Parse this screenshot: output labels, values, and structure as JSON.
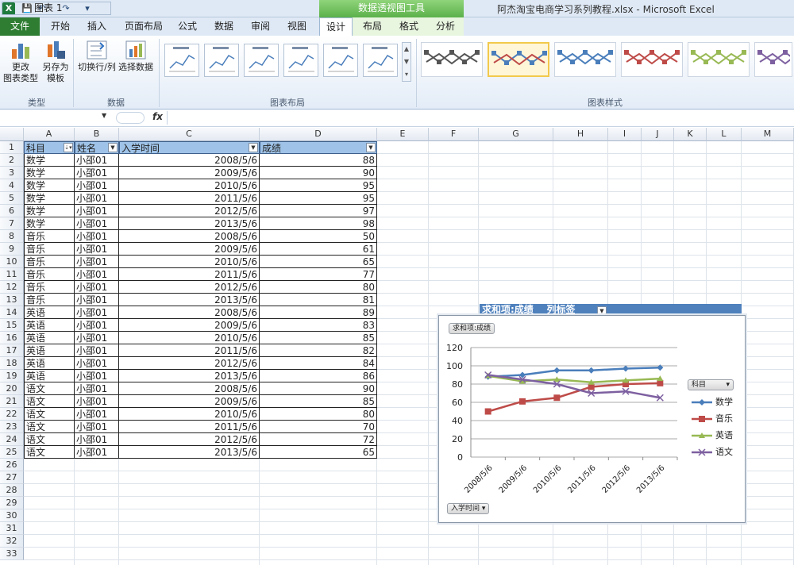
{
  "titlebar": {
    "app_icon": "X",
    "context_group": "数据透视图工具",
    "title": "阿杰淘宝电商学习系列教程.xlsx - Microsoft Excel"
  },
  "tabs": [
    "文件",
    "开始",
    "插入",
    "页面布局",
    "公式",
    "数据",
    "审阅",
    "视图",
    "设计",
    "布局",
    "格式",
    "分析"
  ],
  "ribbon": {
    "change_chart_type": "更改\n图表类型",
    "save_as_template": "另存为\n模板",
    "switch_row_col": "切换行/列",
    "select_data": "选择数据",
    "group_type": "类型",
    "group_data": "数据",
    "group_layout": "图表布局",
    "group_styles": "图表样式"
  },
  "formula_bar": {
    "name_box": "图表 1",
    "fx": "fx"
  },
  "columns": [
    "A",
    "B",
    "C",
    "D",
    "E",
    "F",
    "G",
    "H",
    "I",
    "J",
    "K",
    "L",
    "M"
  ],
  "rows": [
    "1",
    "2",
    "3",
    "4",
    "5",
    "6",
    "7",
    "8",
    "9",
    "10",
    "11",
    "12",
    "13",
    "14",
    "15",
    "16",
    "17",
    "18",
    "19",
    "20",
    "21",
    "22",
    "23",
    "24",
    "25",
    "26",
    "27",
    "28",
    "29",
    "30",
    "31",
    "32",
    "33"
  ],
  "table": {
    "headers": [
      "科目",
      "姓名",
      "入学时间",
      "成绩"
    ],
    "rows": [
      [
        "数学",
        "小邵01",
        "2008/5/6",
        "88"
      ],
      [
        "数学",
        "小邵01",
        "2009/5/6",
        "90"
      ],
      [
        "数学",
        "小邵01",
        "2010/5/6",
        "95"
      ],
      [
        "数学",
        "小邵01",
        "2011/5/6",
        "95"
      ],
      [
        "数学",
        "小邵01",
        "2012/5/6",
        "97"
      ],
      [
        "数学",
        "小邵01",
        "2013/5/6",
        "98"
      ],
      [
        "音乐",
        "小邵01",
        "2008/5/6",
        "50"
      ],
      [
        "音乐",
        "小邵01",
        "2009/5/6",
        "61"
      ],
      [
        "音乐",
        "小邵01",
        "2010/5/6",
        "65"
      ],
      [
        "音乐",
        "小邵01",
        "2011/5/6",
        "77"
      ],
      [
        "音乐",
        "小邵01",
        "2012/5/6",
        "80"
      ],
      [
        "音乐",
        "小邵01",
        "2013/5/6",
        "81"
      ],
      [
        "英语",
        "小邵01",
        "2008/5/6",
        "89"
      ],
      [
        "英语",
        "小邵01",
        "2009/5/6",
        "83"
      ],
      [
        "英语",
        "小邵01",
        "2010/5/6",
        "85"
      ],
      [
        "英语",
        "小邵01",
        "2011/5/6",
        "82"
      ],
      [
        "英语",
        "小邵01",
        "2012/5/6",
        "84"
      ],
      [
        "英语",
        "小邵01",
        "2013/5/6",
        "86"
      ],
      [
        "语文",
        "小邵01",
        "2008/5/6",
        "90"
      ],
      [
        "语文",
        "小邵01",
        "2009/5/6",
        "85"
      ],
      [
        "语文",
        "小邵01",
        "2010/5/6",
        "80"
      ],
      [
        "语文",
        "小邵01",
        "2011/5/6",
        "70"
      ],
      [
        "语文",
        "小邵01",
        "2012/5/6",
        "72"
      ],
      [
        "语文",
        "小邵01",
        "2013/5/6",
        "65"
      ]
    ]
  },
  "pivot_strip": "求和项:成绩    列标签",
  "chart_data": {
    "type": "line",
    "value_field_button": "求和项:成绩",
    "axis_field_button": "入学时间",
    "legend_field_button": "科目",
    "categories": [
      "2008/5/6",
      "2009/5/6",
      "2010/5/6",
      "2011/5/6",
      "2012/5/6",
      "2013/5/6"
    ],
    "ylim": [
      0,
      120
    ],
    "yticks": [
      "0",
      "20",
      "40",
      "60",
      "80",
      "100",
      "120"
    ],
    "grid": true,
    "legend_position": "right",
    "series": [
      {
        "name": "数学",
        "values": [
          88,
          90,
          95,
          95,
          97,
          98
        ],
        "color": "#4a7ebb",
        "marker": "diamond"
      },
      {
        "name": "音乐",
        "values": [
          50,
          61,
          65,
          77,
          80,
          81
        ],
        "color": "#be4b48",
        "marker": "square"
      },
      {
        "name": "英语",
        "values": [
          89,
          83,
          85,
          82,
          84,
          86
        ],
        "color": "#98b954",
        "marker": "triangle"
      },
      {
        "name": "语文",
        "values": [
          90,
          85,
          80,
          70,
          72,
          65
        ],
        "color": "#7d60a0",
        "marker": "x"
      }
    ]
  }
}
